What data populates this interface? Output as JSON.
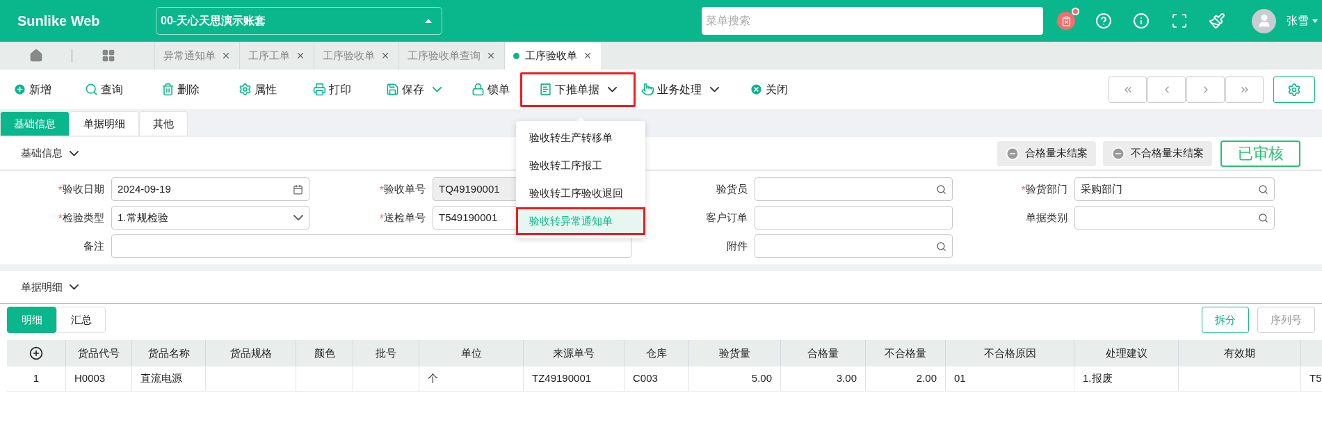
{
  "header": {
    "logo": "Sunlike Web",
    "account": "00-天心天思演示账套",
    "search": {
      "placeholder": "菜单搜索"
    },
    "notification": true,
    "user": "张雪"
  },
  "open_tabs": [
    {
      "label": "异常通知单",
      "selected": false
    },
    {
      "label": "工序工单",
      "selected": false
    },
    {
      "label": "工序验收单",
      "selected": false
    },
    {
      "label": "工序验收单查询",
      "selected": false
    },
    {
      "label": "工序验收单",
      "selected": true
    }
  ],
  "toolbar": [
    {
      "kind": "button",
      "label": "新增",
      "outlined": false
    },
    {
      "kind": "button",
      "label": "查询",
      "outlined": false
    },
    {
      "kind": "button",
      "label": "删除",
      "outlined": false
    },
    {
      "kind": "button",
      "label": "属性",
      "outlined": false
    },
    {
      "kind": "button",
      "label": "打印",
      "outlined": false
    },
    {
      "kind": "dropdown",
      "label": "保存",
      "outlined": false
    },
    {
      "kind": "button",
      "label": "锁单",
      "outlined": false
    },
    {
      "kind": "dropdown",
      "label": "下推单据",
      "outlined": true
    },
    {
      "kind": "dropdown",
      "label": "业务处理",
      "outlined": false
    },
    {
      "kind": "button",
      "label": "关闭",
      "outlined": false
    }
  ],
  "push_menu": [
    {
      "label": "验收转生产转移单",
      "selected": false,
      "outlined": false
    },
    {
      "label": "验收转工序报工",
      "selected": false,
      "outlined": false
    },
    {
      "label": "验收转工序验收退回",
      "selected": false,
      "outlined": false
    },
    {
      "label": "验收转异常通知单",
      "selected": true,
      "outlined": true
    }
  ],
  "form_tabs": [
    {
      "label": "基础信息",
      "selected": true
    },
    {
      "label": "单据明细",
      "selected": false
    },
    {
      "label": "其他",
      "selected": false
    }
  ],
  "basic_section": {
    "title": "基础信息",
    "status_buttons": [
      "合格量未结案",
      "不合格量未结案"
    ],
    "status": "已审核"
  },
  "fields": [
    {
      "label": "验收日期",
      "required_mark": "*",
      "kind": "date",
      "value": "2024-09-19",
      "disabled": false,
      "wide": false
    },
    {
      "label": "验收单号",
      "required_mark": "*",
      "kind": "text",
      "value": "TQ49190001",
      "disabled": true,
      "wide": false
    },
    {
      "label": "验货员",
      "kind": "lookup",
      "disabled": false,
      "wide": false
    },
    {
      "label": "验货部门",
      "required_mark": "*",
      "kind": "lookup",
      "value": "采购部门",
      "disabled": false,
      "wide": false
    },
    {
      "label": "检验类型",
      "required_mark": "*",
      "kind": "select",
      "value": "1.常规检验",
      "disabled": false,
      "wide": false
    },
    {
      "label": "送检单号",
      "required_mark": "*",
      "kind": "text",
      "value": "T549190001",
      "disabled": false,
      "wide": false
    },
    {
      "label": "客户订单",
      "kind": "text",
      "disabled": false,
      "wide": false
    },
    {
      "label": "单据类别",
      "kind": "lookup",
      "disabled": false,
      "wide": false
    },
    {
      "label": "备注",
      "kind": "text",
      "disabled": false,
      "wide": true
    },
    {
      "label": "附件",
      "kind": "lookup",
      "disabled": false,
      "wide": false
    }
  ],
  "detail_section": {
    "title": "单据明细",
    "tabs": [
      {
        "label": "明细",
        "selected": true
      },
      {
        "label": "汇总",
        "selected": false
      }
    ],
    "buttons": [
      {
        "label": "拆分",
        "disabled": false
      },
      {
        "label": "序列号",
        "disabled": true
      }
    ]
  },
  "table": {
    "columns": [
      {
        "kind": "add"
      },
      {
        "kind": "text",
        "label": "货品代号"
      },
      {
        "kind": "text",
        "label": "货品名称"
      },
      {
        "kind": "text",
        "label": "货品规格"
      },
      {
        "kind": "text",
        "label": "颜色"
      },
      {
        "kind": "text",
        "label": "批号"
      },
      {
        "kind": "text",
        "label": "单位"
      },
      {
        "kind": "text",
        "label": "来源单号"
      },
      {
        "kind": "text",
        "label": "仓库"
      },
      {
        "kind": "text",
        "label": "验货量"
      },
      {
        "kind": "text",
        "label": "合格量"
      },
      {
        "kind": "text",
        "label": "不合格量"
      },
      {
        "kind": "text",
        "label": "不合格原因"
      },
      {
        "kind": "text",
        "label": "处理建议"
      },
      {
        "kind": "text",
        "label": "有效期"
      },
      {
        "kind": "blank"
      }
    ],
    "rows": [
      {
        "cells": [
          "1",
          "H0003",
          "直流电源",
          null,
          null,
          null,
          "个",
          "TZ49190001",
          "C003",
          "5.00",
          "3.00",
          "2.00",
          "01",
          "1.报废",
          null,
          "T5"
        ]
      }
    ]
  }
}
